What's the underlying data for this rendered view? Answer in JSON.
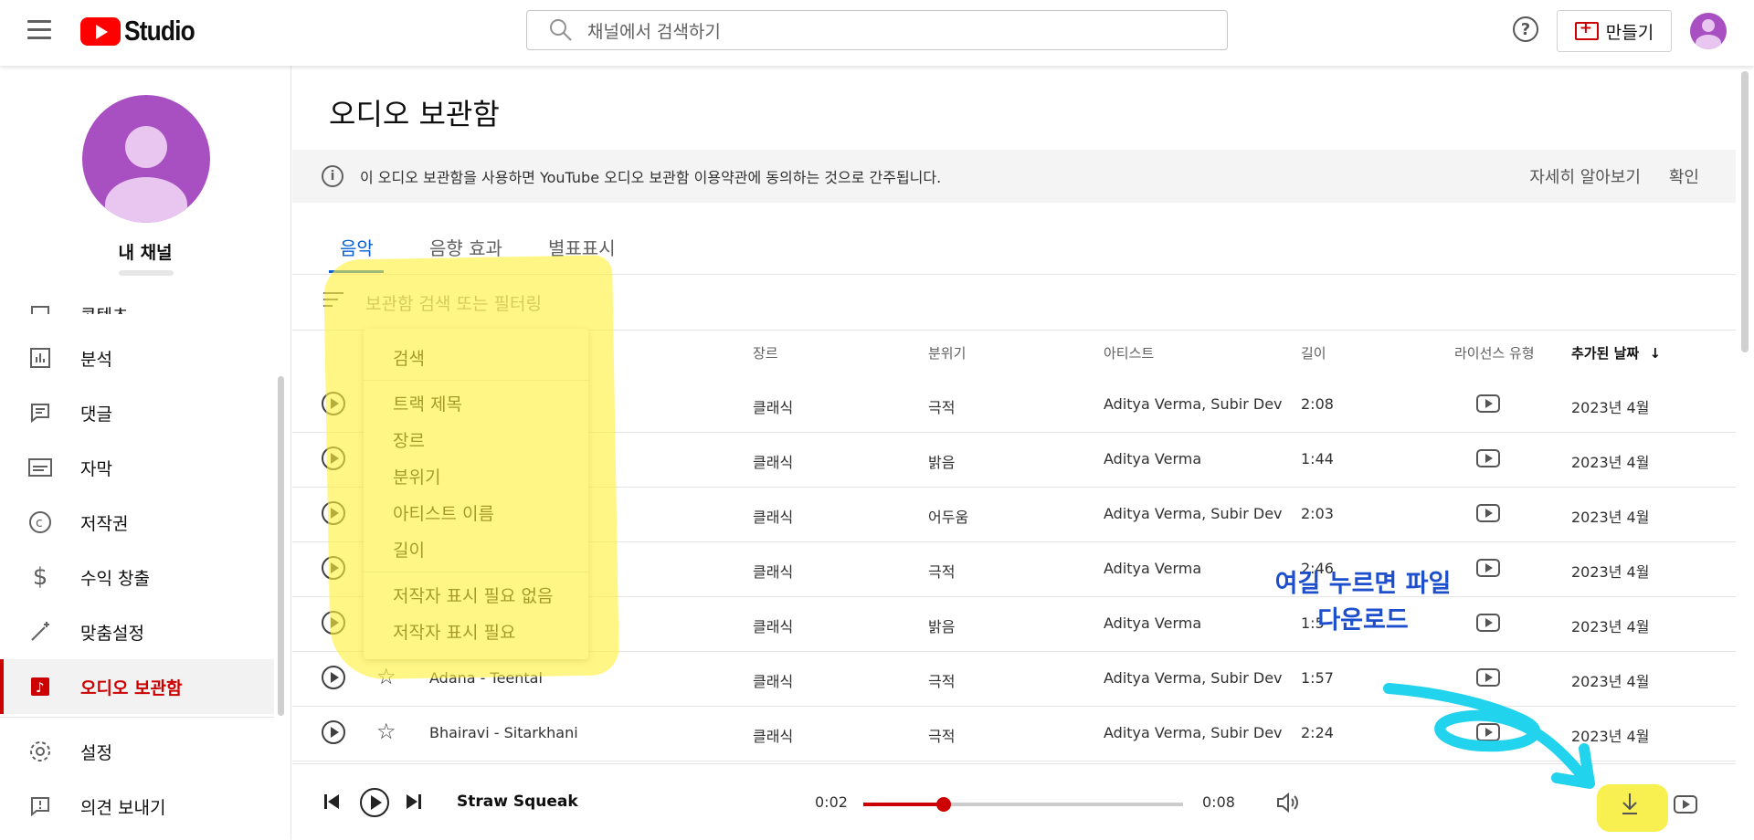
{
  "header": {
    "logo_text": "Studio",
    "search_placeholder": "채널에서 검색하기",
    "help_symbol": "?",
    "create_label": "만들기"
  },
  "sidebar": {
    "channel_name": "내 채널",
    "items": [
      {
        "label": "콘텐츠",
        "icon": "content-icon"
      },
      {
        "label": "분석",
        "icon": "analytics-icon"
      },
      {
        "label": "댓글",
        "icon": "comments-icon"
      },
      {
        "label": "자막",
        "icon": "subtitles-icon"
      },
      {
        "label": "저작권",
        "icon": "copyright-icon"
      },
      {
        "label": "수익 창출",
        "icon": "dollar-icon"
      },
      {
        "label": "맞춤설정",
        "icon": "magic-wand-icon"
      },
      {
        "label": "오디오 보관함",
        "icon": "audio-library-icon",
        "active": true
      },
      {
        "label": "설정",
        "icon": "gear-icon"
      },
      {
        "label": "의견 보내기",
        "icon": "feedback-icon"
      }
    ]
  },
  "main": {
    "title": "오디오 보관함",
    "banner": {
      "text": "이 오디오 보관함을 사용하면 YouTube 오디오 보관함 이용약관에 동의하는 것으로 간주됩니다.",
      "learn_more": "자세히 알아보기",
      "confirm": "확인"
    },
    "tabs": [
      "음악",
      "음향 효과",
      "별표표시"
    ],
    "filter_placeholder": "보관함 검색 또는 필터링",
    "columns": {
      "genre": "장르",
      "mood": "분위기",
      "artist": "아티스트",
      "length": "길이",
      "license": "라이선스 유형",
      "added": "추가된 날짜"
    },
    "rows": [
      {
        "title": "",
        "genre": "클래식",
        "mood": "극적",
        "artist": "Aditya Verma, Subir Dev",
        "length": "2:08",
        "added": "2023년 4월"
      },
      {
        "title": "",
        "genre": "클래식",
        "mood": "밝음",
        "artist": "Aditya Verma",
        "length": "1:44",
        "added": "2023년 4월"
      },
      {
        "title": "",
        "genre": "클래식",
        "mood": "어두움",
        "artist": "Aditya Verma, Subir Dev",
        "length": "2:03",
        "added": "2023년 4월"
      },
      {
        "title": "",
        "genre": "클래식",
        "mood": "극적",
        "artist": "Aditya Verma",
        "length": "2:46",
        "added": "2023년 4월"
      },
      {
        "title": "",
        "genre": "클래식",
        "mood": "밝음",
        "artist": "Aditya Verma",
        "length": "1:5",
        "added": "2023년 4월"
      },
      {
        "title": "Adana - Teental",
        "genre": "클래식",
        "mood": "극적",
        "artist": "Aditya Verma, Subir Dev",
        "length": "1:57",
        "added": "2023년 4월"
      },
      {
        "title": "Bhairavi - Sitarkhani",
        "genre": "클래식",
        "mood": "극적",
        "artist": "Aditya Verma, Subir Dev",
        "length": "2:24",
        "added": "2023년 4월"
      }
    ]
  },
  "menu": {
    "search": "검색",
    "items": [
      "트랙 제목",
      "장르",
      "분위기",
      "아티스트 이름",
      "길이"
    ],
    "attribution": [
      "저작자 표시 필요 없음",
      "저작자 표시 필요"
    ]
  },
  "annotation": {
    "line1": "여길 누르면 파일",
    "line2": "다운로드"
  },
  "player": {
    "track": "Straw Squeak",
    "current": "0:02",
    "duration": "0:08",
    "progress_fraction": 0.25
  },
  "colors": {
    "accent_red": "#cc0000",
    "tab_blue": "#065fd4",
    "highlight_yellow": "#fff03c",
    "annotation_blue": "#1d4fcc",
    "arrow_cyan": "#22d3ee"
  }
}
